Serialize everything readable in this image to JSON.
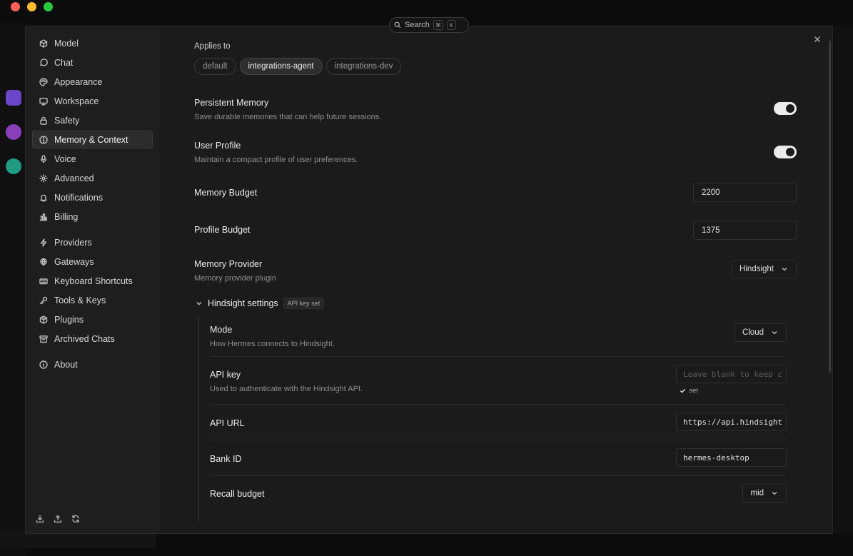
{
  "search": {
    "label": "Search",
    "key1": "⌘",
    "key2": "K"
  },
  "sidebar": {
    "items": [
      {
        "id": "model",
        "label": "Model",
        "icon": "cube-icon"
      },
      {
        "id": "chat",
        "label": "Chat",
        "icon": "chat-bubble-icon"
      },
      {
        "id": "appearance",
        "label": "Appearance",
        "icon": "palette-icon"
      },
      {
        "id": "workspace",
        "label": "Workspace",
        "icon": "monitor-icon"
      },
      {
        "id": "safety",
        "label": "Safety",
        "icon": "lock-icon"
      },
      {
        "id": "memory",
        "label": "Memory & Context",
        "icon": "brain-icon",
        "active": true
      },
      {
        "id": "voice",
        "label": "Voice",
        "icon": "microphone-icon"
      },
      {
        "id": "advanced",
        "label": "Advanced",
        "icon": "gear-icon"
      },
      {
        "id": "notifications",
        "label": "Notifications",
        "icon": "bell-icon"
      },
      {
        "id": "billing",
        "label": "Billing",
        "icon": "bar-chart-icon"
      },
      {
        "id": "providers",
        "label": "Providers",
        "icon": "bolt-icon"
      },
      {
        "id": "gateways",
        "label": "Gateways",
        "icon": "globe-icon"
      },
      {
        "id": "shortcuts",
        "label": "Keyboard Shortcuts",
        "icon": "keyboard-icon"
      },
      {
        "id": "tools",
        "label": "Tools & Keys",
        "icon": "key-icon"
      },
      {
        "id": "plugins",
        "label": "Plugins",
        "icon": "package-icon"
      },
      {
        "id": "archived",
        "label": "Archived Chats",
        "icon": "archive-icon"
      },
      {
        "id": "about",
        "label": "About",
        "icon": "info-icon"
      }
    ]
  },
  "content": {
    "applies_to_label": "Applies to",
    "chips": [
      {
        "label": "default",
        "selected": false
      },
      {
        "label": "integrations-agent",
        "selected": true
      },
      {
        "label": "integrations-dev",
        "selected": false
      }
    ],
    "persistent_memory": {
      "title": "Persistent Memory",
      "desc": "Save durable memories that can help future sessions.",
      "enabled": true
    },
    "user_profile": {
      "title": "User Profile",
      "desc": "Maintain a compact profile of user preferences.",
      "enabled": true
    },
    "memory_budget": {
      "title": "Memory Budget",
      "value": "2200"
    },
    "profile_budget": {
      "title": "Profile Budget",
      "value": "1375"
    },
    "memory_provider": {
      "title": "Memory Provider",
      "desc": "Memory provider plugin",
      "value": "Hindsight"
    },
    "hindsight": {
      "title": "Hindsight settings",
      "badge": "API key set",
      "mode": {
        "title": "Mode",
        "desc": "How Hermes connects to Hindsight.",
        "value": "Cloud"
      },
      "api_key": {
        "title": "API key",
        "desc": "Used to authenticate with the Hindsight API.",
        "placeholder": "Leave blank to keep c",
        "set_note": "set"
      },
      "api_url": {
        "title": "API URL",
        "value": "https://api.hindsight"
      },
      "bank_id": {
        "title": "Bank ID",
        "value": "hermes-desktop"
      },
      "recall_budget": {
        "title": "Recall budget",
        "value": "mid"
      }
    }
  }
}
